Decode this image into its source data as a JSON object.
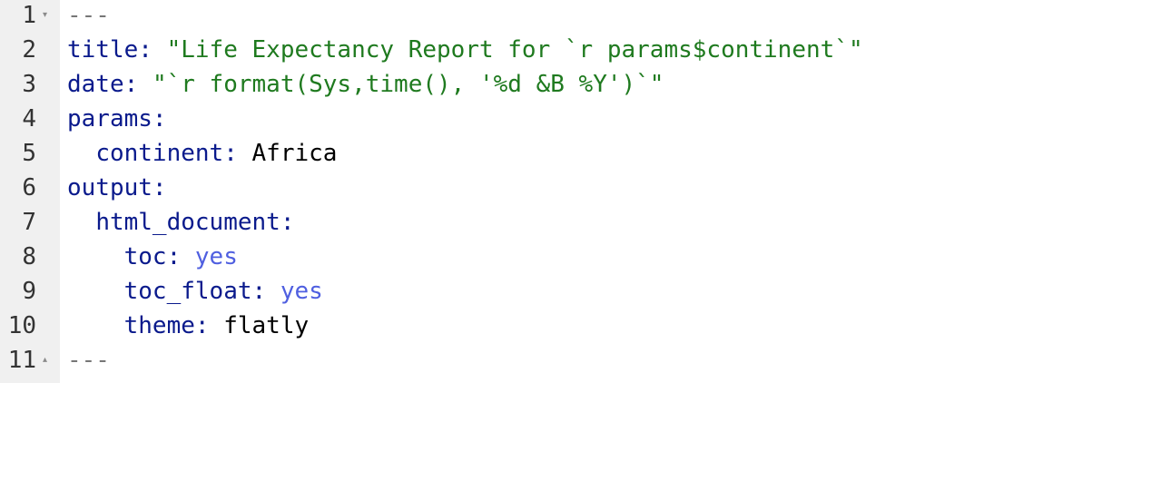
{
  "gutter": {
    "line_numbers": [
      "1",
      "2",
      "3",
      "4",
      "5",
      "6",
      "7",
      "8",
      "9",
      "10",
      "11"
    ],
    "fold_open": "▾",
    "fold_close": "▴"
  },
  "code": {
    "line1": {
      "text": "---"
    },
    "line2": {
      "key": "title",
      "sep": ": ",
      "value": "\"Life Expectancy Report for `r params$continent`\""
    },
    "line3": {
      "key": "date",
      "sep": ": ",
      "value": "\"`r format(Sys,time(), '%d &B %Y')`\""
    },
    "line4": {
      "key": "params",
      "sep": ":"
    },
    "line5": {
      "indent": "  ",
      "key": "continent",
      "sep": ": ",
      "value": "Africa"
    },
    "line6": {
      "key": "output",
      "sep": ":"
    },
    "line7": {
      "indent": "  ",
      "key": "html_document",
      "sep": ":"
    },
    "line8": {
      "indent": "    ",
      "key": "toc",
      "sep": ": ",
      "value": "yes"
    },
    "line9": {
      "indent": "    ",
      "key": "toc_float",
      "sep": ": ",
      "value": "yes"
    },
    "line10": {
      "indent": "    ",
      "key": "theme",
      "sep": ": ",
      "value": "flatly"
    },
    "line11": {
      "text": "---"
    }
  },
  "colors": {
    "gutter_bg": "#f0f0f0",
    "key": "#0a1a8c",
    "string": "#1f7a1f",
    "boolean": "#4f5fe0",
    "delimiter": "#777777",
    "plain": "#000000"
  }
}
